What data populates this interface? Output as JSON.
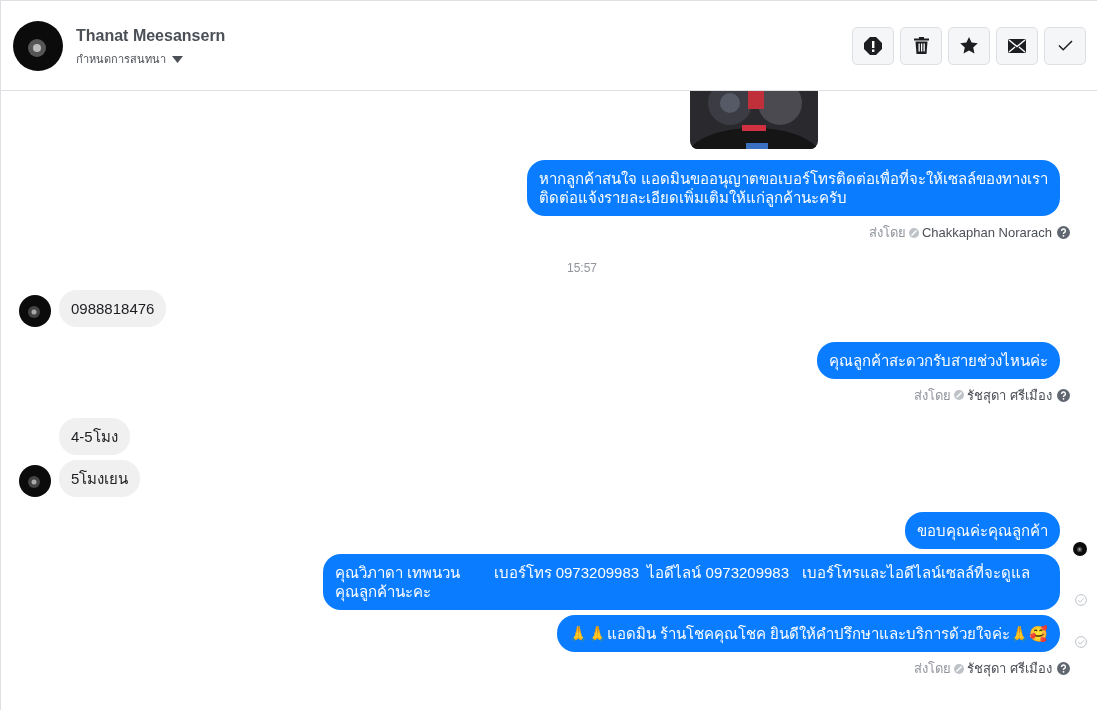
{
  "header": {
    "name": "Thanat Meesansern",
    "subtitle": "กำหนดการสนทนา",
    "actions": [
      {
        "kind": "alert"
      },
      {
        "kind": "trash"
      },
      {
        "kind": "star"
      },
      {
        "kind": "mail"
      },
      {
        "kind": "check"
      }
    ]
  },
  "messages": [
    {
      "kind": "picture"
    },
    {
      "kind": "outgoing",
      "seen": false,
      "delivered": false,
      "text": "หากลูกค้าสนใจ แอดมินขออนุญาตขอเบอร์โทรติดต่อเพื่อที่จะให้เซลล์ของทางเรา\nติดต่อแจ้งรายละเอียดเพิ่มเติมให้แก่ลูกค้านะครับ"
    },
    {
      "kind": "sent_by",
      "label": "ส่งโดย",
      "agent": "Chakkaphan Norarach"
    },
    {
      "kind": "time",
      "text": "15:57"
    },
    {
      "kind": "incoming",
      "avatar": true,
      "text": "0988818476"
    },
    {
      "kind": "outgoing",
      "seen": false,
      "delivered": false,
      "text": "คุณลูกค้าสะดวกรับสายช่วงไหนค่ะ"
    },
    {
      "kind": "sent_by",
      "label": "ส่งโดย",
      "agent": "รัชสุดา ศรีเมือง"
    },
    {
      "kind": "incoming",
      "avatar": false,
      "text": "4-5โมง"
    },
    {
      "kind": "incoming",
      "avatar": true,
      "text": "5โมงเยน"
    },
    {
      "kind": "outgoing",
      "seen": true,
      "delivered": false,
      "text": "ขอบคุณค่ะคุณลูกค้า"
    },
    {
      "kind": "outgoing",
      "seen": false,
      "delivered": true,
      "text": "คุณวิภาดา เทพนวน        เบอร์โทร 0973209983  ไอดีไลน์ 0973209983   เบอร์โทรและไอดีไลน์เซลล์ที่จะดูแลคุณลูกค้านะคะ"
    },
    {
      "kind": "outgoing",
      "seen": false,
      "delivered": true,
      "text": "🙏🙏แอดมิน ร้านโชคคุณโชค ยินดีให้คำปรึกษาและบริการด้วยใจค่ะ🙏🥰"
    },
    {
      "kind": "sent_by",
      "label": "ส่งโดย",
      "agent": "รัชสุดา ศรีเมือง"
    }
  ]
}
